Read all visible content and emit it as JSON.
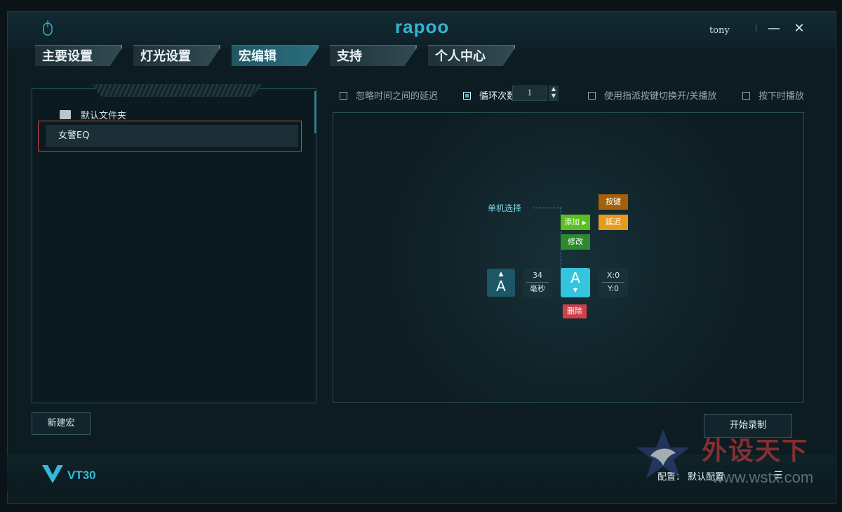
{
  "app": {
    "brand": "rapoo",
    "user": "tony",
    "model": "VT30"
  },
  "window": {
    "minimize": "—",
    "close": "✕"
  },
  "tabs": [
    {
      "label": "主要设置"
    },
    {
      "label": "灯光设置"
    },
    {
      "label": "宏编辑"
    },
    {
      "label": "支持"
    },
    {
      "label": "个人中心"
    }
  ],
  "active_tab": "宏编辑",
  "macro_list": {
    "folder": "默认文件夹",
    "items": [
      {
        "label": "女警EQ"
      }
    ],
    "new_button": "新建宏"
  },
  "options": {
    "ignore_delay": "忽略时间之间的延迟",
    "loop_count_label": "循环次数",
    "loop_count_value": "1",
    "toggle_play": "使用指派按键切换开/关播放",
    "press_play": "按下时播放"
  },
  "editor": {
    "single_select": "单机选择",
    "add": "添加",
    "modify": "修改",
    "key": "按键",
    "delay": "延迟",
    "delete": "删除",
    "key_down": {
      "arrow": "▲",
      "key": "A"
    },
    "delay_value": "34",
    "delay_unit": "毫秒",
    "key_up": {
      "key": "A",
      "arrow": "▼"
    },
    "coord_x": "X:0",
    "coord_y": "Y:0"
  },
  "record_button": "开始录制",
  "footer": {
    "config_label": "配置：",
    "config_value": "默认配置"
  },
  "watermark": {
    "text": "外设天下",
    "url": "www.wstx.com"
  },
  "colors": {
    "accent": "#2fb7d4",
    "add": "#5bbf1e",
    "modify": "#2e8a2e",
    "key": "#a4600a",
    "delay": "#e89a1c",
    "delete": "#d0404a",
    "selected_border": "#d0454a"
  }
}
